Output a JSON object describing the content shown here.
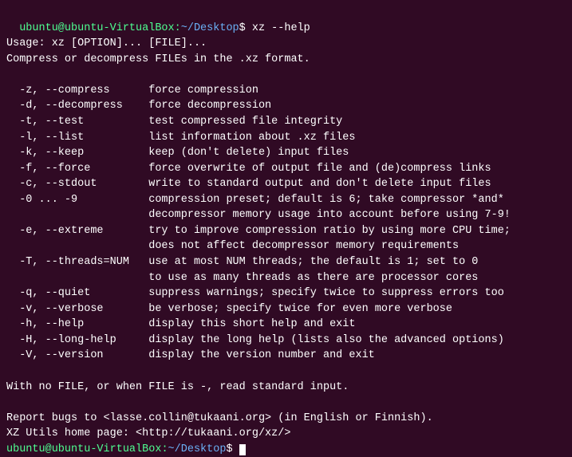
{
  "terminal": {
    "title": "ubuntu@ubuntu-VirtualBox:~/Desktop",
    "prompt_user": "ubuntu",
    "prompt_host": "ubuntu-VirtualBox",
    "prompt_path": "~/Desktop",
    "command": "xz --help",
    "lines": [
      "Usage: xz [OPTION]... [FILE]...",
      "Compress or decompress FILEs in the .xz format.",
      "",
      "  -z, --compress      force compression",
      "  -d, --decompress    force decompression",
      "  -t, --test          test compressed file integrity",
      "  -l, --list          list information about .xz files",
      "  -k, --keep          keep (don't delete) input files",
      "  -f, --force         force overwrite of output file and (de)compress links",
      "  -c, --stdout        write to standard output and don't delete input files",
      "  -0 ... -9           compression preset; default is 6; take compressor *and*",
      "                      decompressor memory usage into account before using 7-9!",
      "  -e, --extreme       try to improve compression ratio by using more CPU time;",
      "                      does not affect decompressor memory requirements",
      "  -T, --threads=NUM   use at most NUM threads; the default is 1; set to 0",
      "                      to use as many threads as there are processor cores",
      "  -q, --quiet         suppress warnings; specify twice to suppress errors too",
      "  -v, --verbose       be verbose; specify twice for even more verbose",
      "  -h, --help          display this short help and exit",
      "  -H, --long-help     display the long help (lists also the advanced options)",
      "  -V, --version       display the version number and exit",
      "",
      "With no FILE, or when FILE is -, read standard input.",
      "",
      "Report bugs to <lasse.collin@tukaani.org> (in English or Finnish).",
      "XZ Utils home page: <http://tukaani.org/xz/>"
    ],
    "final_prompt_user": "ubuntu",
    "final_prompt_host": "ubuntu-VirtualBox",
    "final_prompt_path": "~/Desktop"
  }
}
